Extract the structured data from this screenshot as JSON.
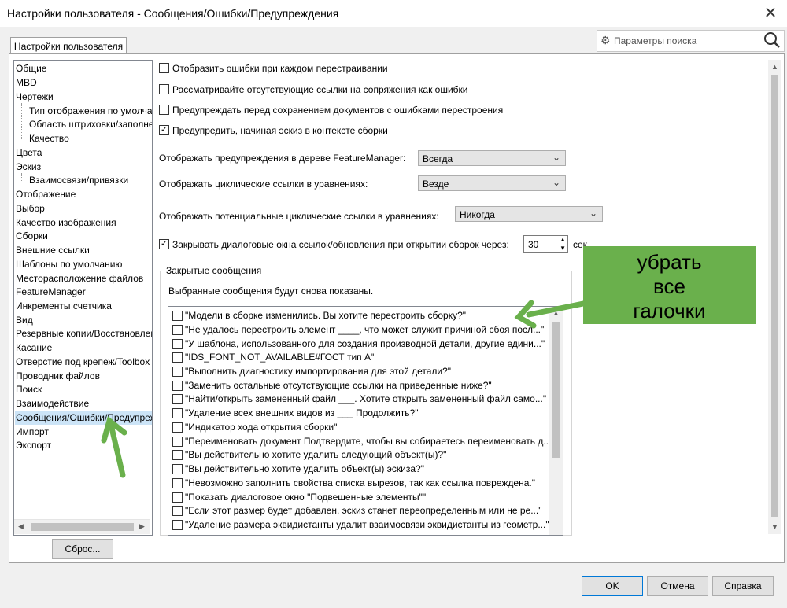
{
  "window": {
    "title": "Настройки пользователя - Сообщения/Ошибки/Предупреждения"
  },
  "tab": {
    "label": "Настройки пользователя"
  },
  "search": {
    "placeholder": "Параметры поиска"
  },
  "tree": {
    "items": [
      {
        "label": "Общие"
      },
      {
        "label": "MBD"
      },
      {
        "label": "Чертежи"
      },
      {
        "label": "Тип отображения по умолча"
      },
      {
        "label": "Область штриховки/заполне"
      },
      {
        "label": "Качество"
      },
      {
        "label": "Цвета"
      },
      {
        "label": "Эскиз"
      },
      {
        "label": "Взаимосвязи/привязки"
      },
      {
        "label": "Отображение"
      },
      {
        "label": "Выбор"
      },
      {
        "label": "Качество изображения"
      },
      {
        "label": "Сборки"
      },
      {
        "label": "Внешние ссылки"
      },
      {
        "label": "Шаблоны по умолчанию"
      },
      {
        "label": "Месторасположение файлов"
      },
      {
        "label": "FeatureManager"
      },
      {
        "label": "Инкременты счетчика"
      },
      {
        "label": "Вид"
      },
      {
        "label": "Резервные копии/Восстановлени"
      },
      {
        "label": "Касание"
      },
      {
        "label": "Отверстие под крепеж/Toolbox"
      },
      {
        "label": "Проводник файлов"
      },
      {
        "label": "Поиск"
      },
      {
        "label": "Взаимодействие"
      },
      {
        "label": "Сообщения/Ошибки/Предупреж"
      },
      {
        "label": "Импорт"
      },
      {
        "label": "Экспорт"
      }
    ]
  },
  "reset_label": "Сброс...",
  "options": {
    "o1": {
      "label": "Отобразить ошибки при каждом перестраивании",
      "checked": false
    },
    "o2": {
      "label": "Рассматривайте отсутствующие ссылки на сопряжения как ошибки",
      "checked": false
    },
    "o3": {
      "label": "Предупреждать перед сохранением документов с ошибками перестроения",
      "checked": false
    },
    "o4": {
      "label": "Предупредить, начиная эскиз в контексте сборки",
      "checked": true
    },
    "fm_label": "Отображать предупреждения в дереве FeatureManager:",
    "fm_value": "Всегда",
    "cyc_label": "Отображать циклические ссылки в уравнениях:",
    "cyc_value": "Везде",
    "pcyc_label": "Отображать потенциальные циклические ссылки в уравнениях:",
    "pcyc_value": "Никогда",
    "close_label": "Закрывать диалоговые окна ссылок/обновления при открытии сборок через:",
    "close_checked": true,
    "close_value": "30",
    "close_unit": "сек"
  },
  "closed_messages": {
    "group_label": "Закрытые сообщения",
    "info": "Выбранные сообщения будут снова показаны.",
    "items": [
      "\"Модели в сборке изменились.  Вы хотите перестроить сборку?\"",
      "\"Не удалось перестроить элемент ____, что может служит причиной сбоя посл...\"",
      "\"У шаблона, использованного для создания производной детали, другие едини...\"",
      "\"IDS_FONT_NOT_AVAILABLE#ГОСТ тип А\"",
      "\"Выполнить диагностику импортирования для этой детали?\"",
      "\"Заменить остальные отсутствующие ссылки на приведенные ниже?\"",
      "\"Найти/открыть замененный файл ___.  Хотите открыть замененный файл само...\"",
      "\"Удаление всех внешних видов из ___ Продолжить?\"",
      "\"Индикатор хода открытия сборки\"",
      "\"Переименовать документ Подтвердите, чтобы вы собираетесь переименовать д...\"",
      "\"Вы действительно хотите удалить следующий объект(ы)?\"",
      "\"Вы действительно хотите удалить объект(ы) эскиза?\"",
      "\"Невозможно заполнить свойства списка вырезов, так как ссылка повреждена.\"",
      "\"Показать диалоговое окно \"Подвешенные элементы\"\"",
      "\"Если этот размер будет добавлен, эскиз станет переопределенным или не ре...\"",
      "\"Удаление размера эквидистанты удалит взаимосвязи эквидистанты из геометр...\""
    ]
  },
  "annotation": {
    "text": "убрать все галочки",
    "color": "#6ab04c"
  },
  "buttons": {
    "ok": "OK",
    "cancel": "Отмена",
    "help": "Справка"
  }
}
